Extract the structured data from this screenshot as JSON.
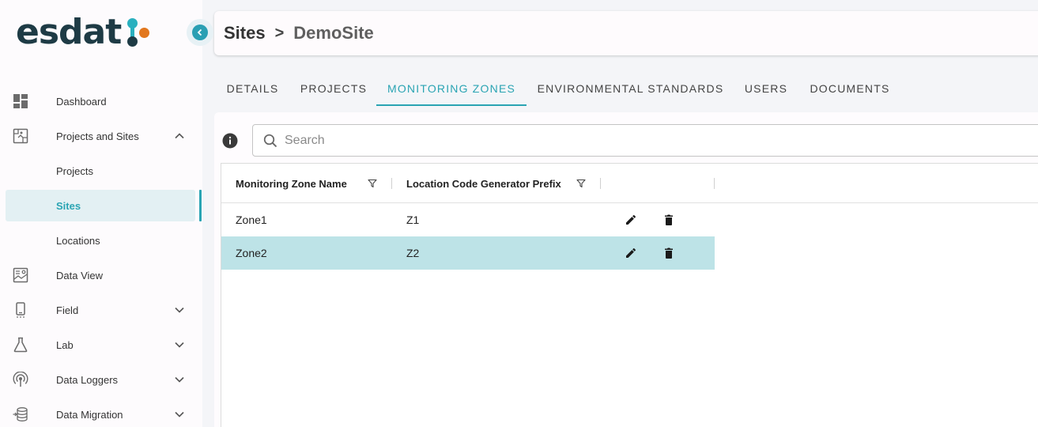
{
  "sidebar": {
    "logo_text": "esdat",
    "logo_colors": {
      "text": "#1e3b45",
      "teal": "#2ab0bf",
      "orange": "#e2771e"
    },
    "items": [
      {
        "label": "Dashboard",
        "icon": "dashboard-icon"
      },
      {
        "label": "Projects and Sites",
        "icon": "map-icon",
        "expanded": true
      },
      {
        "label": "Projects"
      },
      {
        "label": "Sites",
        "active": true
      },
      {
        "label": "Locations"
      },
      {
        "label": "Data View",
        "icon": "data-view-icon"
      },
      {
        "label": "Field",
        "icon": "field-device-icon",
        "expanded": false
      },
      {
        "label": "Lab",
        "icon": "flask-icon",
        "expanded": false
      },
      {
        "label": "Data Loggers",
        "icon": "data-logger-icon",
        "expanded": false
      },
      {
        "label": "Data Migration",
        "icon": "database-icon",
        "expanded": false
      }
    ]
  },
  "header": {
    "breadcrumb": [
      "Sites",
      "DemoSite"
    ],
    "separator": ">"
  },
  "tabs": [
    {
      "label": "DETAILS"
    },
    {
      "label": "PROJECTS"
    },
    {
      "label": "MONITORING ZONES",
      "active": true
    },
    {
      "label": "ENVIRONMENTAL STANDARDS"
    },
    {
      "label": "USERS"
    },
    {
      "label": "DOCUMENTS"
    }
  ],
  "search": {
    "placeholder": "Search",
    "value": ""
  },
  "grid": {
    "columns": [
      "Monitoring Zone Name",
      "Location Code Generator Prefix"
    ],
    "rows": [
      {
        "name": "Zone1",
        "prefix": "Z1",
        "selected": false
      },
      {
        "name": "Zone2",
        "prefix": "Z2",
        "selected": true
      }
    ]
  },
  "colors": {
    "accent": "#2aa4b3",
    "selected_row": "#bde3e7"
  }
}
